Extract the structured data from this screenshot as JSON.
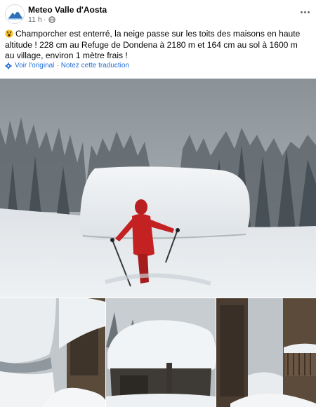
{
  "post": {
    "page_name": "Meteo Valle d'Aosta",
    "time": "11 h",
    "separator": "·",
    "body": "Champorcher est enterré, la neige passe sur les toits des maisons en haute altitude ! 228 cm au Refuge de Dondena à 2180 m et 164 cm au sol à 1600 m au village, environ 1 mètre frais !",
    "emoji_icon": "face-with-open-mouth-emoji",
    "privacy_icon": "globe-icon"
  },
  "translation": {
    "see_original": "Voir l'original",
    "separator": "·",
    "rate": "Notez cette traduction"
  },
  "photos": {
    "main": "snow-buried-chalet-skier-photo",
    "thumbs": [
      "snow-on-roofs-photo",
      "snow-capped-stone-hut-photo",
      "wooden-balcony-snowfall-photo"
    ]
  },
  "colors": {
    "link": "#216fdb",
    "meta": "#65676b",
    "text": "#050505"
  }
}
